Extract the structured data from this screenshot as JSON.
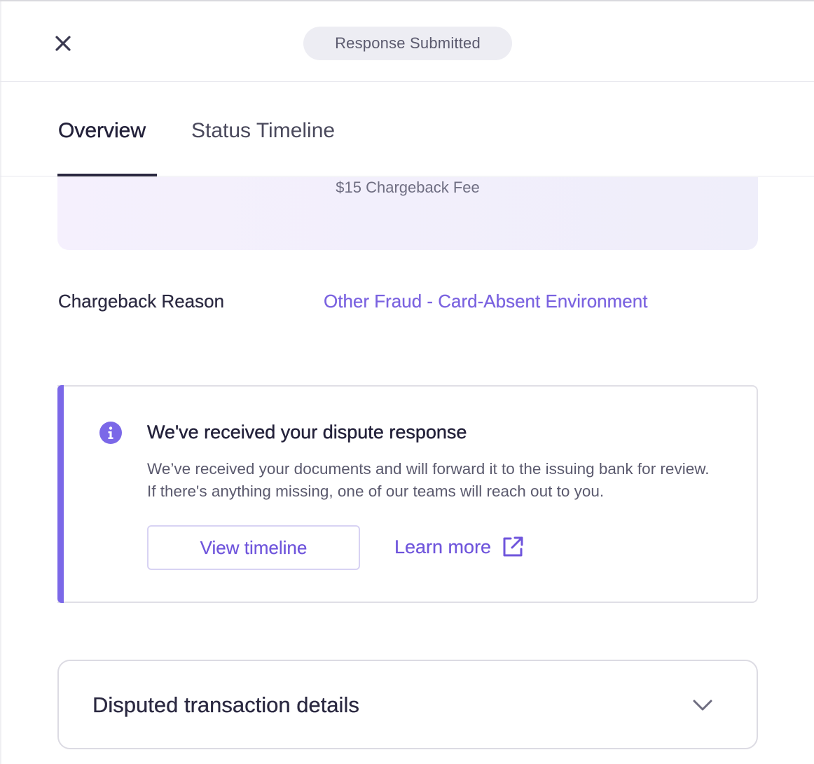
{
  "header": {
    "status": "Response Submitted"
  },
  "tabs": [
    {
      "label": "Overview",
      "active": true
    },
    {
      "label": "Status Timeline",
      "active": false
    }
  ],
  "fee_card": {
    "fee_text": "$15 Chargeback Fee"
  },
  "reason": {
    "label": "Chargeback Reason",
    "value": "Other Fraud - Card-Absent Environment"
  },
  "alert": {
    "title": "We've received your dispute response",
    "body": "We’ve received your documents and will forward it to the issuing bank for review. If there's anything missing, one of our teams will reach out to you.",
    "primary_button": "View timeline",
    "link": "Learn more"
  },
  "accordion": {
    "title": "Disputed transaction details"
  },
  "colors": {
    "accent": "#7b68e8",
    "link": "#6f55dc",
    "text_dark": "#23213a",
    "pill_bg": "#ededf3"
  },
  "icons": [
    "close-icon",
    "info-icon",
    "external-link-icon",
    "chevron-down-icon"
  ]
}
